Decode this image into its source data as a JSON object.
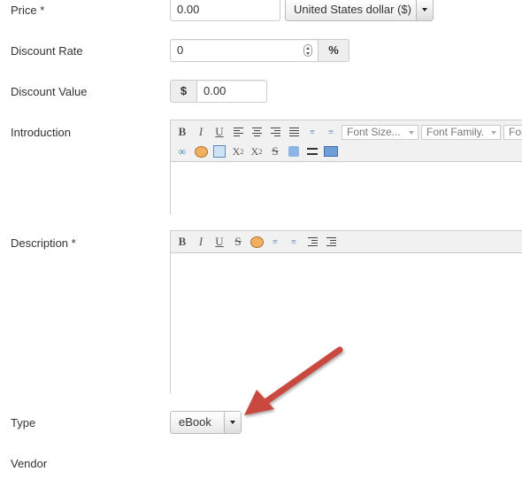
{
  "price": {
    "label": "Price *",
    "value": "0.00",
    "currency": "United States dollar ($)"
  },
  "discount_rate": {
    "label": "Discount Rate",
    "value": "0",
    "unit": "%"
  },
  "discount_value": {
    "label": "Discount Value",
    "prefix": "$",
    "value": "0.00"
  },
  "introduction": {
    "label": "Introduction",
    "font_size_placeholder": "Font Size...",
    "font_family_placeholder": "Font Family.",
    "font_format_partial": "Font"
  },
  "description": {
    "label": "Description *"
  },
  "type": {
    "label": "Type",
    "value": "eBook"
  },
  "vendor": {
    "label": "Vendor"
  },
  "colors": {
    "arrow": "#c94a3f"
  }
}
